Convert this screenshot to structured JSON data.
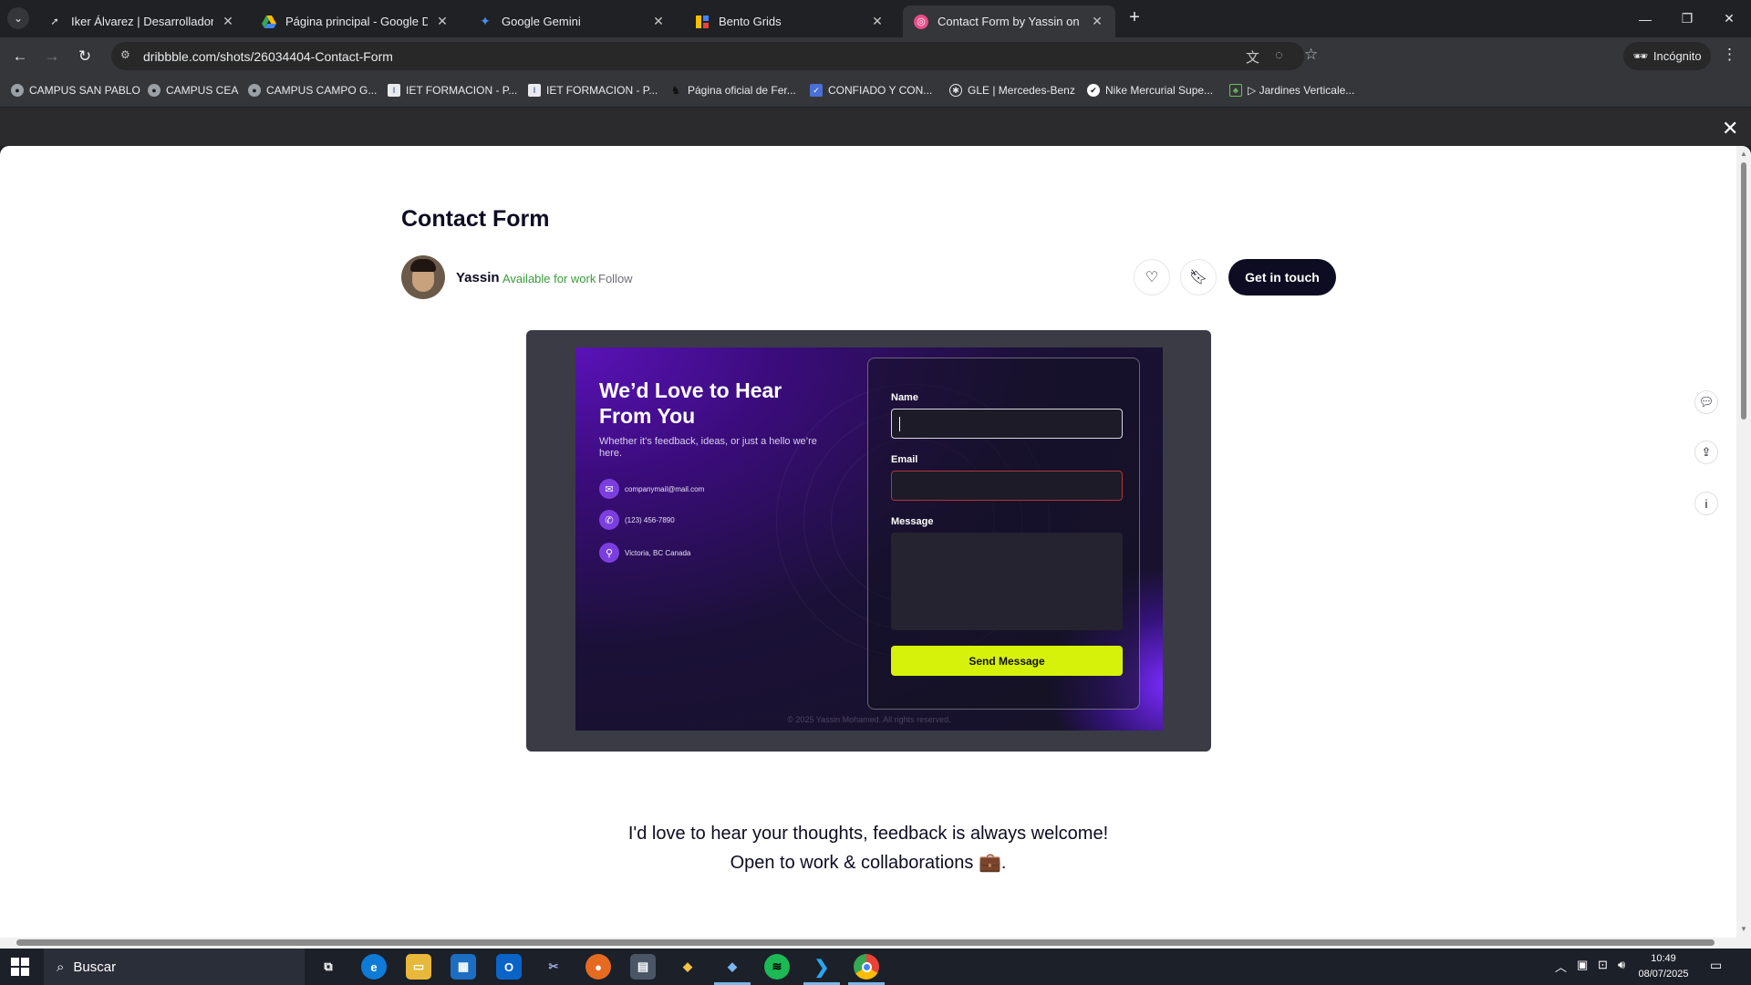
{
  "browser": {
    "tabs": [
      {
        "title": "Iker Álvarez | Desarrollador y pr",
        "icon": "arrow-logo-icon",
        "active": false
      },
      {
        "title": "Página principal - Google Drive",
        "icon": "google-drive-icon",
        "active": false
      },
      {
        "title": "Google Gemini",
        "icon": "gemini-sparkle-icon",
        "active": false
      },
      {
        "title": "Bento Grids",
        "icon": "bento-grids-icon",
        "active": false
      },
      {
        "title": "Contact Form by Yassin on Drib",
        "icon": "dribbble-icon",
        "active": true
      }
    ],
    "url": "dribbble.com/shots/26034404-Contact-Form",
    "incognito_label": "Incógnito",
    "bookmarks": [
      "CAMPUS SAN PABLO",
      "CAMPUS CEA",
      "CAMPUS CAMPO G...",
      "IET FORMACION - P...",
      "IET FORMACION - P...",
      "Página oficial de Fer...",
      "CONFIADO Y CON...",
      "GLE | Mercedes-Benz",
      "Nike Mercurial Supe...",
      "▷ Jardines Verticale..."
    ]
  },
  "shot": {
    "title": "Contact Form",
    "author": "Yassin",
    "availability": "Available for work",
    "follow_label": "Follow",
    "cta_label": "Get in touch",
    "preview": {
      "heading": "We’d Love to Hear From You",
      "subheading": "Whether it’s feedback, ideas, or just a hello we’re here.",
      "contacts": [
        {
          "icon": "mail-icon",
          "text": "companymail@mail.com"
        },
        {
          "icon": "phone-icon",
          "text": "(123) 456-7890"
        },
        {
          "icon": "location-pin-icon",
          "text": "Victoria, BC Canada"
        }
      ],
      "name_label": "Name",
      "email_label": "Email",
      "message_label": "Message",
      "send_label": "Send Message",
      "copyright": "© 2025 Yassin Mohamed. All rights reserved."
    },
    "description_line1": "I'd love to hear your thoughts, feedback is always welcome!",
    "description_line2": "Open to work & collaborations 💼."
  },
  "taskbar": {
    "search_placeholder": "Buscar",
    "time": "10:49",
    "date": "08/07/2025"
  },
  "colors": {
    "accent_lime": "#d7f20a",
    "dribbble_dark": "#0d0c22",
    "available_green": "#3a9b3a"
  }
}
